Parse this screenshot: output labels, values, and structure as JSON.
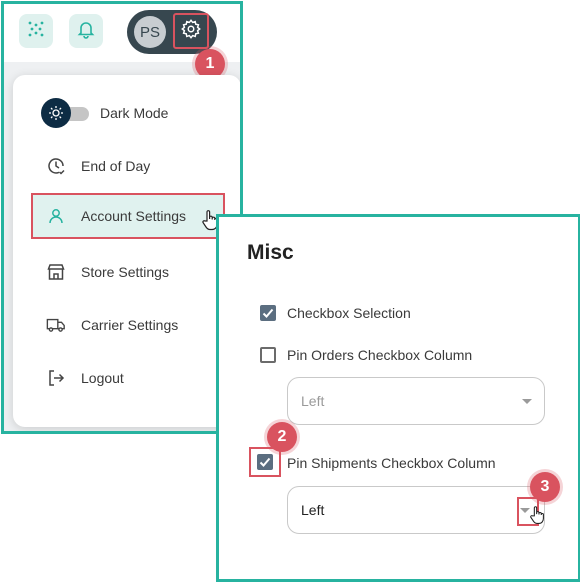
{
  "topbar": {
    "avatar_initials": "PS",
    "steps": {
      "step1": "1",
      "step2": "2",
      "step3": "3"
    }
  },
  "menu": {
    "items": [
      {
        "label": "Dark Mode",
        "icon": "sun-icon"
      },
      {
        "label": "End of Day",
        "icon": "clock-check-icon"
      },
      {
        "label": "Account Settings",
        "icon": "user-icon"
      },
      {
        "label": "Store Settings",
        "icon": "store-icon"
      },
      {
        "label": "Carrier Settings",
        "icon": "truck-icon"
      },
      {
        "label": "Logout",
        "icon": "logout-icon"
      }
    ]
  },
  "misc": {
    "title": "Misc",
    "checkbox_selection": {
      "label": "Checkbox Selection",
      "checked": true
    },
    "pin_orders": {
      "label": "Pin Orders Checkbox Column",
      "checked": false,
      "select_value": "Left"
    },
    "pin_shipments": {
      "label": "Pin Shipments Checkbox Column",
      "checked": true,
      "select_value": "Left"
    }
  },
  "colors": {
    "accent": "#27b3a0",
    "highlight": "#d9535f",
    "dark": "#37474f"
  }
}
